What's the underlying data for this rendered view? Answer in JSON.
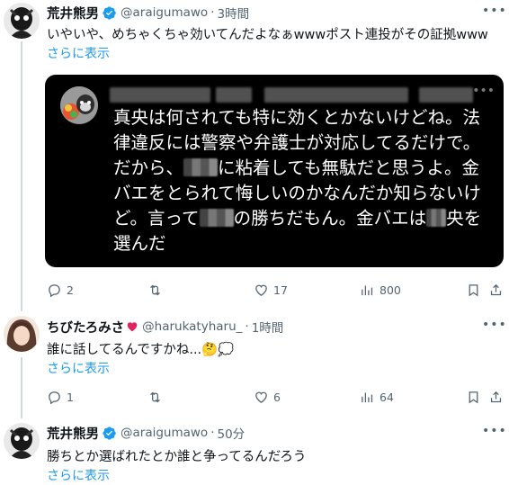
{
  "posts": [
    {
      "name": "荒井熊男",
      "handle": "@araigumawo",
      "time": "3時間",
      "text": "いやいや、めちゃくちゃ効いてんだよなぁwwwポスト連投がその証拠www",
      "show_more": "さらに表示",
      "embedded_image": {
        "lines": [
          "真央は何されても特に効くとかないけどね。法",
          "律違反には警察や弁護士が対応してるだけで。",
          "だから、",
          "に粘着しても無駄だと思うよ。金",
          "バエをとられて悔しいのかなんだか知らないけ",
          "ど。言って",
          "の勝ちだもん。金バエは",
          "央を",
          "選んだ"
        ]
      },
      "counts": {
        "reply": "2",
        "repost": "",
        "like": "17",
        "views": "800"
      }
    },
    {
      "name": "ちびたろみさ",
      "handle": "@harukatyharu_",
      "time": "1時間",
      "text": "誰に話してるんですかね...",
      "emoji": "🤔💭",
      "show_more": "さらに表示",
      "counts": {
        "reply": "1",
        "repost": "",
        "like": "6",
        "views": "64"
      }
    },
    {
      "name": "荒井熊男",
      "handle": "@araigumawo",
      "time": "50分",
      "text": "勝ちとか選ばれたとか誰と争ってるんだろう",
      "show_more": "さらに表示"
    }
  ],
  "colors": {
    "accent": "#1d9bf0",
    "secondary": "#536471",
    "heart": "#e0245e"
  },
  "icons": [
    "verified-badge-icon",
    "more-icon",
    "reply-icon",
    "repost-icon",
    "like-icon",
    "views-icon",
    "bookmark-icon",
    "share-icon"
  ]
}
